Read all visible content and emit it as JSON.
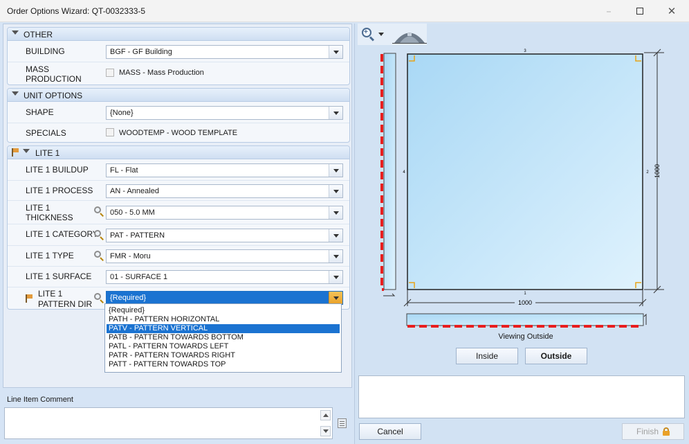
{
  "window": {
    "title": "Order Options Wizard: QT-0032333-5",
    "minimize_glyph": "–",
    "close_glyph": "✕"
  },
  "groups": {
    "other": {
      "title": "OTHER",
      "building_label": "BUILDING",
      "building_value": "BGF - GF Building",
      "mass_label_1": "MASS",
      "mass_label_2": "PRODUCTION",
      "mass_checkbox_label": "MASS - Mass Production"
    },
    "unit_options": {
      "title": "UNIT OPTIONS",
      "shape_label": "SHAPE",
      "shape_value": "{None}",
      "specials_label": "SPECIALS",
      "specials_checkbox_label": "WOODTEMP - WOOD TEMPLATE"
    },
    "lite1": {
      "title": "LITE 1",
      "buildup_label": "LITE 1 BUILDUP",
      "buildup_value": "FL - Flat",
      "process_label": "LITE 1 PROCESS",
      "process_value": "AN - Annealed",
      "thickness_label_1": "LITE 1",
      "thickness_label_2": "THICKNESS",
      "thickness_value": "050 - 5.0 MM",
      "category_label": "LITE 1 CATEGORY",
      "category_value": "PAT - PATTERN",
      "type_label": "LITE 1 TYPE",
      "type_value": "FMR - Moru",
      "surface_label": "LITE 1 SURFACE",
      "surface_value": "01 - SURFACE 1",
      "pattern_dir_label_1": "LITE 1",
      "pattern_dir_label_2": "PATTERN DIR",
      "pattern_dir_value": "{Required}"
    }
  },
  "pattern_dir_options": [
    {
      "label": "{Required}",
      "selected": false
    },
    {
      "label": "PATH - PATTERN HORIZONTAL",
      "selected": false
    },
    {
      "label": "PATV - PATTERN VERTICAL",
      "selected": true
    },
    {
      "label": "PATB - PATTERN TOWARDS BOTTOM",
      "selected": false
    },
    {
      "label": "PATL - PATTERN TOWARDS LEFT",
      "selected": false
    },
    {
      "label": "PATR - PATTERN TOWARDS RIGHT",
      "selected": false
    },
    {
      "label": "PATT - PATTERN TOWARDS TOP",
      "selected": false
    }
  ],
  "comment": {
    "label": "Line Item Comment",
    "value": ""
  },
  "drawing": {
    "width_dim": "1000",
    "height_dim": "1000",
    "edge_top": "3",
    "edge_right": "2",
    "edge_bottom": "1",
    "edge_left": "4",
    "viewing_label": "Viewing Outside",
    "colors": {
      "glass": "#bfe3f7",
      "edge_marker": "#e81e1e",
      "corner": "#e8a317"
    }
  },
  "view_buttons": {
    "inside": "Inside",
    "outside": "Outside"
  },
  "footer": {
    "cancel": "Cancel",
    "finish": "Finish"
  },
  "icons": [
    "zoom-in-icon",
    "arch-shape-icon",
    "search-icon",
    "flag-icon",
    "notes-icon",
    "lock-icon"
  ]
}
